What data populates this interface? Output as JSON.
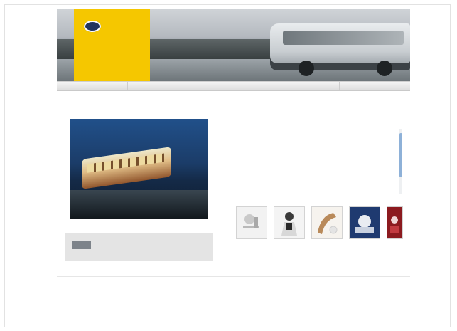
{
  "header": {
    "logo_word": "",
    "logo_caption": "",
    "caption": ""
  },
  "nav": {
    "items": [
      {
        "label": ""
      },
      {
        "label": ""
      },
      {
        "label": ""
      },
      {
        "label": ""
      },
      {
        "label": ""
      }
    ]
  },
  "breadcrumb": "",
  "main": {
    "title": "",
    "paragraphs": [
      "",
      "",
      "",
      ""
    ]
  },
  "info_box": {
    "lines": [
      "",
      "",
      ""
    ]
  },
  "thumbnails": [
    {
      "label": "",
      "icon": "parking-sign-icon"
    },
    {
      "label": "",
      "icon": "person-icon"
    },
    {
      "label": "",
      "icon": "telephone-icon"
    },
    {
      "label": "",
      "icon": "coach-photo-icon"
    },
    {
      "label": "",
      "icon": "red-photo-icon"
    }
  ],
  "footer": {
    "text": "",
    "link": ""
  },
  "colors": {
    "brand_yellow": "#f5c700",
    "nav_gray": "#dcdcdc",
    "link_blue": "#66799a",
    "scrollbar_blue": "#8eb1d8"
  }
}
